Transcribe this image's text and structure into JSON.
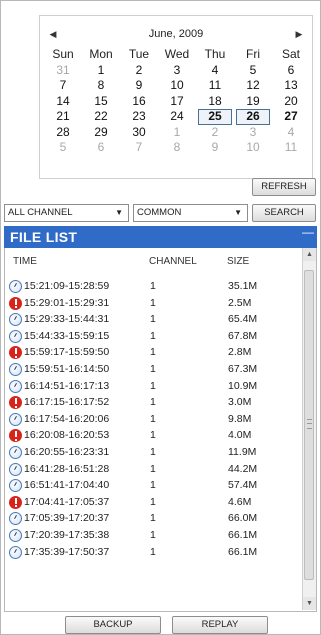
{
  "calendar": {
    "prev_icon": "caret-left-icon",
    "next_icon": "caret-right-icon",
    "title": "June, 2009",
    "days_of_week": [
      "Sun",
      "Mon",
      "Tue",
      "Wed",
      "Thu",
      "Fri",
      "Sat"
    ],
    "weeks": [
      [
        "31",
        "1",
        "2",
        "3",
        "4",
        "5",
        "6"
      ],
      [
        "7",
        "8",
        "9",
        "10",
        "11",
        "12",
        "13"
      ],
      [
        "14",
        "15",
        "16",
        "17",
        "18",
        "19",
        "20"
      ],
      [
        "21",
        "22",
        "23",
        "24",
        "25",
        "26",
        "27"
      ],
      [
        "28",
        "29",
        "30",
        "1",
        "2",
        "3",
        "4"
      ],
      [
        "5",
        "6",
        "7",
        "8",
        "9",
        "10",
        "11"
      ]
    ],
    "selected_dates": [
      "25",
      "26"
    ],
    "today": "27"
  },
  "controls": {
    "refresh_label": "REFRESH",
    "channel_select": "ALL CHANNEL",
    "mode_select": "COMMON",
    "search_label": "SEARCH"
  },
  "file_list": {
    "title": "FILE LIST",
    "minimize_glyph": "—",
    "columns": {
      "time": "TIME",
      "channel": "CHANNEL",
      "size": "SIZE"
    },
    "rows": [
      {
        "icon": "normal",
        "time": "15:21:09-15:28:59",
        "channel": "1",
        "size": "35.1M"
      },
      {
        "icon": "alert",
        "time": "15:29:01-15:29:31",
        "channel": "1",
        "size": "2.5M"
      },
      {
        "icon": "normal",
        "time": "15:29:33-15:44:31",
        "channel": "1",
        "size": "65.4M"
      },
      {
        "icon": "normal",
        "time": "15:44:33-15:59:15",
        "channel": "1",
        "size": "67.8M"
      },
      {
        "icon": "alert",
        "time": "15:59:17-15:59:50",
        "channel": "1",
        "size": "2.8M"
      },
      {
        "icon": "normal",
        "time": "15:59:51-16:14:50",
        "channel": "1",
        "size": "67.3M"
      },
      {
        "icon": "normal",
        "time": "16:14:51-16:17:13",
        "channel": "1",
        "size": "10.9M"
      },
      {
        "icon": "alert",
        "time": "16:17:15-16:17:52",
        "channel": "1",
        "size": "3.0M"
      },
      {
        "icon": "normal",
        "time": "16:17:54-16:20:06",
        "channel": "1",
        "size": "9.8M"
      },
      {
        "icon": "alert",
        "time": "16:20:08-16:20:53",
        "channel": "1",
        "size": "4.0M"
      },
      {
        "icon": "normal",
        "time": "16:20:55-16:23:31",
        "channel": "1",
        "size": "11.9M"
      },
      {
        "icon": "normal",
        "time": "16:41:28-16:51:28",
        "channel": "1",
        "size": "44.2M"
      },
      {
        "icon": "normal",
        "time": "16:51:41-17:04:40",
        "channel": "1",
        "size": "57.4M"
      },
      {
        "icon": "alert",
        "time": "17:04:41-17:05:37",
        "channel": "1",
        "size": "4.6M"
      },
      {
        "icon": "normal",
        "time": "17:05:39-17:20:37",
        "channel": "1",
        "size": "66.0M"
      },
      {
        "icon": "normal",
        "time": "17:20:39-17:35:38",
        "channel": "1",
        "size": "66.1M"
      },
      {
        "icon": "normal",
        "time": "17:35:39-17:50:37",
        "channel": "1",
        "size": "66.1M"
      }
    ]
  },
  "footer": {
    "backup_label": "BACKUP",
    "replay_label": "REPLAY"
  }
}
